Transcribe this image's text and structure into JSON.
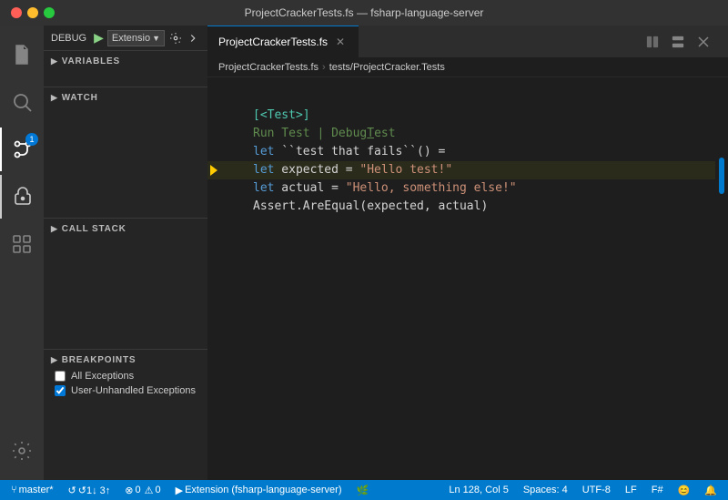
{
  "titlebar": {
    "title": "ProjectCrackerTests.fs — fsharp-language-server"
  },
  "debug": {
    "label": "DEBUG",
    "config": "Extensio",
    "play_button": "▶"
  },
  "sidebar": {
    "variables_label": "VARIABLES",
    "watch_label": "WATCH",
    "callstack_label": "CALL STACK",
    "breakpoints_label": "BREAKPOINTS",
    "breakpoint_items": [
      {
        "id": "bp-all",
        "label": "All Exceptions",
        "checked": false
      },
      {
        "id": "bp-unhandled",
        "label": "User-Unhandled Exceptions",
        "checked": true
      }
    ]
  },
  "editor": {
    "tab_filename": "ProjectCrackerTests.fs",
    "breadcrumb_path": "tests/ProjectCracker.Tests",
    "lines": [
      {
        "num": "",
        "code": ""
      },
      {
        "num": "",
        "tokens": [
          {
            "class": "attr",
            "text": "[<Test>]"
          }
        ]
      },
      {
        "num": "",
        "tokens": [
          {
            "class": "comment",
            "text": "Run Test | Debug Test"
          }
        ]
      },
      {
        "num": "",
        "tokens": [
          {
            "class": "kw",
            "text": "let"
          },
          {
            "class": "plain",
            "text": " "
          },
          {
            "class": "plain",
            "text": "``test that fails``() ="
          }
        ]
      },
      {
        "num": "",
        "tokens": [
          {
            "class": "plain",
            "text": "    "
          },
          {
            "class": "kw",
            "text": "let"
          },
          {
            "class": "plain",
            "text": " expected = "
          },
          {
            "class": "str",
            "text": "\"Hello test!\""
          }
        ]
      },
      {
        "num": "",
        "tokens": [
          {
            "class": "plain",
            "text": "    "
          },
          {
            "class": "kw",
            "text": "let"
          },
          {
            "class": "plain",
            "text": " actual = "
          },
          {
            "class": "str",
            "text": "\"Hello, something else!\""
          }
        ]
      },
      {
        "num": "",
        "tokens": [
          {
            "class": "plain",
            "text": "    Assert.AreEqual(expected, actual)"
          }
        ]
      }
    ]
  },
  "status": {
    "branch": "master*",
    "sync": "↺1↓ 3↑",
    "errors": "0",
    "warnings": "0",
    "run_label": "▶ Extension (fsharp-language-server)",
    "position": "Ln 128, Col 5",
    "spaces": "Spaces: 4",
    "encoding": "UTF-8",
    "line_ending": "LF",
    "language": "F#",
    "leaf_icon": "🌿",
    "bell_icon": "🔔",
    "smiley_icon": "😊"
  },
  "icons": {
    "files": "📄",
    "search": "🔍",
    "source_control": "⑂",
    "debug": "🐛",
    "extensions": "⬜",
    "settings": "⚙"
  }
}
